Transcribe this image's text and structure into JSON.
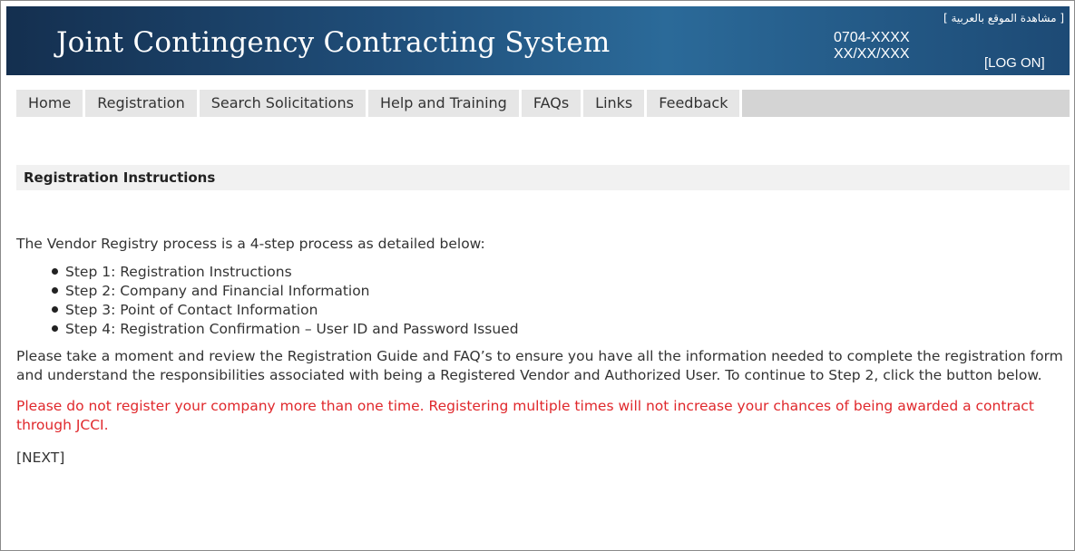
{
  "header": {
    "title": "Joint Contingency Contracting System",
    "phone": "0704-XXXX",
    "date": "XX/XX/XXX",
    "arabic_link": "[ مشاهدة الموقع بالعربية ]",
    "logon": "[LOG ON]"
  },
  "nav": {
    "items": [
      {
        "label": "Home"
      },
      {
        "label": "Registration"
      },
      {
        "label": "Search Solicitations"
      },
      {
        "label": "Help and Training"
      },
      {
        "label": "FAQs"
      },
      {
        "label": "Links"
      },
      {
        "label": "Feedback"
      }
    ]
  },
  "section": {
    "title": "Registration Instructions"
  },
  "content": {
    "intro": "The Vendor Registry process is a 4-step process as detailed below:",
    "steps": [
      "Step 1: Registration Instructions",
      "Step 2: Company and Financial Information",
      "Step 3: Point of Contact Information",
      "Step 4: Registration Confirmation – User ID and Password Issued"
    ],
    "paragraph": "Please take a moment and review the Registration Guide and FAQ’s to ensure you have all the information needed to complete the registration form and understand the responsibilities associated with being a Registered Vendor and Authorized User. To continue to Step 2, click the button below.",
    "warning": "Please do not register your company more than one time. Registering multiple times will not increase your chances of being awarded a contract through JCCI.",
    "next_label": "[NEXT]"
  },
  "colors": {
    "banner": "#1f4d78",
    "warning": "#e0282c",
    "nav_bg": "#e6e6e6"
  }
}
